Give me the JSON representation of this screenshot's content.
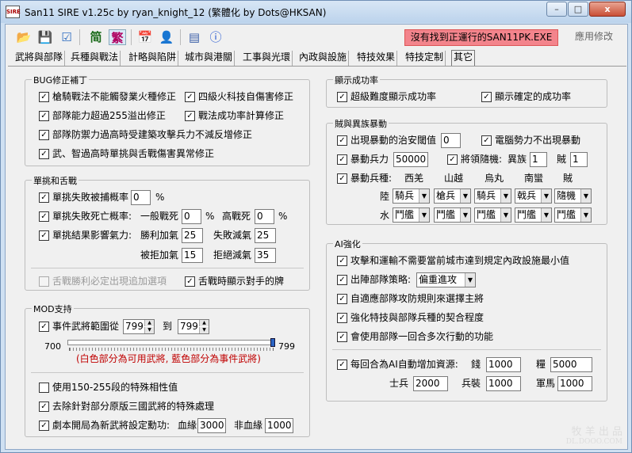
{
  "window": {
    "title": "San11 SIRE v1.25c by ryan_knight_12 (繁體化 by Dots@HKSAN)",
    "icon_text": "SIRE",
    "minimize": "–",
    "maximize": "□",
    "close": "x"
  },
  "toolbar": {
    "status": "沒有找到正運行的SAN11PK.EXE",
    "apply": "應用修改",
    "simplified": "简",
    "traditional": "繁"
  },
  "tabs": [
    "武將與部隊",
    "兵種與戰法",
    "計略與陷阱",
    "城市與港關",
    "工事與光環",
    "內政與設施",
    "特技效果",
    "特技定制",
    "其它"
  ],
  "bug": {
    "title": "BUG修正補丁",
    "items": [
      "槍騎戰法不能觸發業火種修正",
      "四級火科技自傷害修正",
      "部隊能力超過255溢出修正",
      "戰法成功率計算修正",
      "部隊防禦力過高時受建築攻擊兵力不減反增修正",
      "武、智過高時單挑與舌戰傷害異常修正"
    ]
  },
  "duel": {
    "title": "單挑和舌戰",
    "capture_label": "單挑失敗被捕概率",
    "capture_val": "0",
    "pct": "%",
    "death_label": "單挑失敗死亡概率:",
    "normal_death": "一般戰死",
    "normal_val": "0",
    "high_death": "高戰死",
    "high_val": "0",
    "morale_label": "單挑結果影響氣力:",
    "win_add": "勝利加氣",
    "win_add_val": "25",
    "lose_sub": "失敗減氣",
    "lose_sub_val": "25",
    "cap_add": "被拒加氣",
    "cap_add_val": "15",
    "ref_sub": "拒絕減氣",
    "ref_sub_val": "35",
    "debate_extra": "舌戰勝利必定出現追加選項",
    "debate_show": "舌戰時顯示對手的牌"
  },
  "mod": {
    "title": "MOD支持",
    "range_label": "事件武將範圍從",
    "from": "799",
    "to_label": "到",
    "to": "799",
    "slider_min": "700",
    "slider_max": "799",
    "slider_value": 799,
    "slider_note": "(白色部分為可用武將, 藍色部分為事件武將)",
    "opt1": "使用150-255段的特殊相性值",
    "opt2": "去除針對部分原版三國武將的特殊處理",
    "opt3": "劇本開局為新武將設定勳功:",
    "blood": "血緣",
    "blood_val": "3000",
    "nonblood": "非血緣",
    "nonblood_val": "1000"
  },
  "success": {
    "title": "顯示成功率",
    "super": "超級難度顯示成功率",
    "exact": "顯示確定的成功率"
  },
  "riot": {
    "title": "賊與異族暴動",
    "threshold": "出現暴動的治安閾值",
    "threshold_val": "0",
    "no_ai": "電腦勢力不出現暴動",
    "troops": "暴動兵力",
    "troops_val": "50000",
    "leader": "將領隨機:",
    "alien": "異族",
    "alien_val": "1",
    "bandit": "賊",
    "bandit_val": "1",
    "type_label": "暴動兵種:",
    "cols": [
      "西羌",
      "山越",
      "烏丸",
      "南蠻",
      "賊"
    ],
    "land": "陸",
    "land_vals": [
      "騎兵",
      "槍兵",
      "騎兵",
      "戟兵",
      "隨機"
    ],
    "water": "水",
    "water_vals": [
      "鬥艦",
      "鬥艦",
      "鬥艦",
      "鬥艦",
      "鬥艦"
    ]
  },
  "ai": {
    "title": "AI強化",
    "i1": "攻擊和運輸不需要當前城市達到規定內政設施最小值",
    "i2": "出陣部隊策略:",
    "strategy": "偏重進攻",
    "i3": "自適應部隊攻防規則來選擇主將",
    "i4": "強化特技與部隊兵種的契合程度",
    "i5": "會使用部隊一回合多次行動的功能",
    "i6": "每回合為AI自動增加資源:",
    "gold": "錢",
    "gold_val": "1000",
    "food": "糧",
    "food_val": "5000",
    "soldier": "士兵",
    "soldier_val": "2000",
    "equip": "兵裝",
    "equip_val": "1000",
    "ship": "軍馬",
    "ship_val": "1000"
  },
  "watermark": {
    "line1": "牧 羊 出 品",
    "line2": "DL.DOOO.COM"
  }
}
